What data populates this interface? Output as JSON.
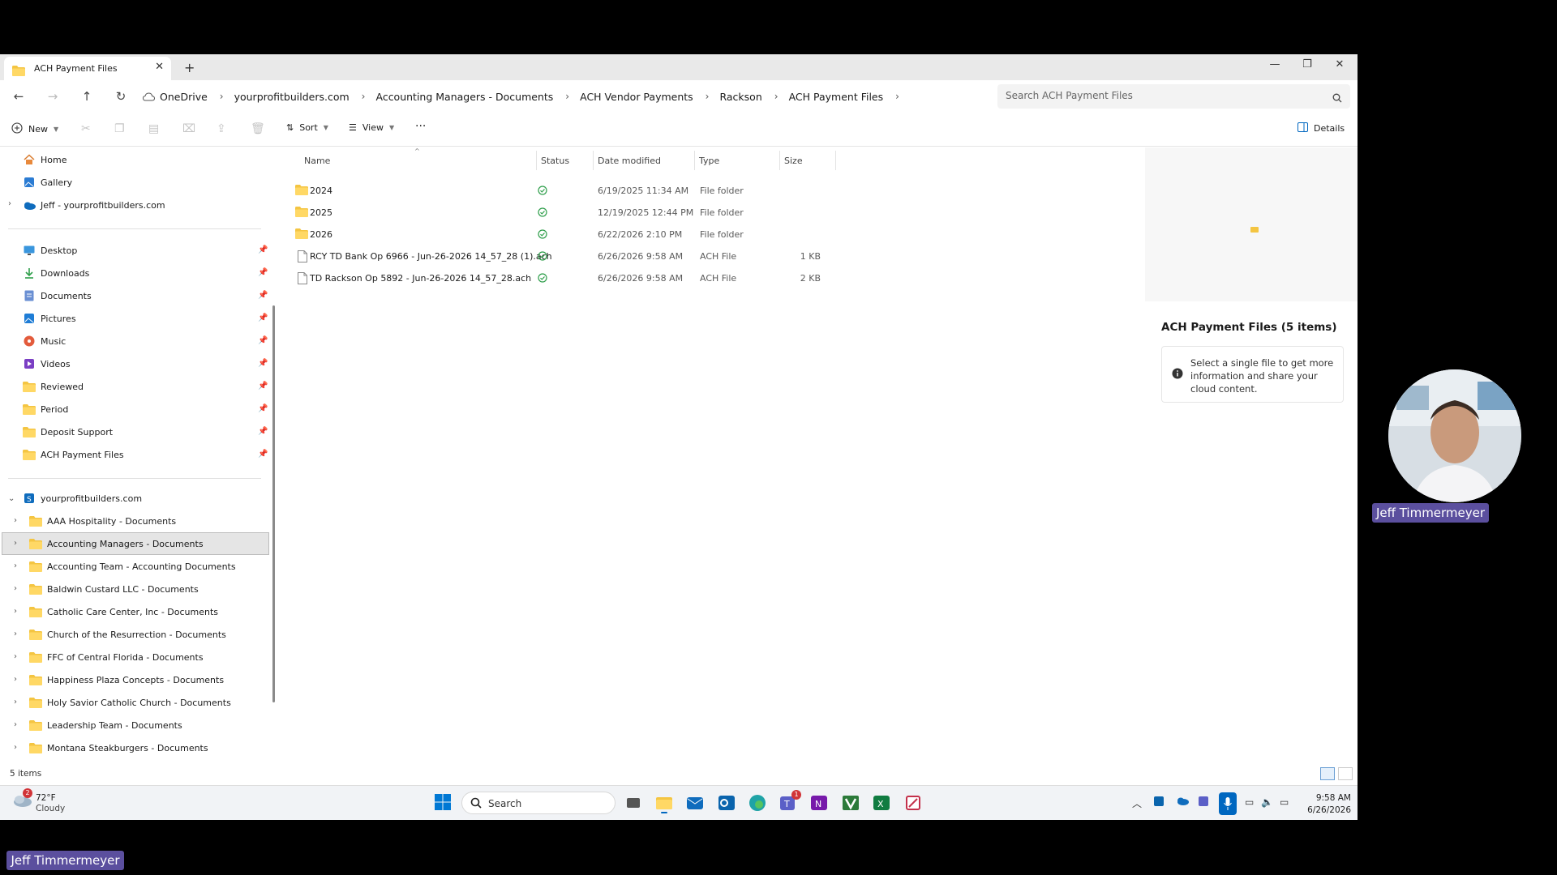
{
  "window": {
    "tab_title": "ACH Payment Files",
    "tab_close": "✕",
    "new_tab": "+",
    "controls": {
      "minimize": "—",
      "restore": "❐",
      "close": "✕"
    }
  },
  "address": {
    "breadcrumbs": [
      "OneDrive",
      "yourprofitbuilders.com",
      "Accounting Managers - Documents",
      "ACH Vendor Payments",
      "Rackson",
      "ACH Payment Files"
    ],
    "separator": "›",
    "search_placeholder": "Search ACH Payment Files"
  },
  "toolbar": {
    "new_label": "New",
    "sort_label": "Sort",
    "view_label": "View",
    "more_label": "···",
    "details_label": "Details"
  },
  "nav": {
    "top_items": [
      {
        "label": "Home",
        "icon": "home-icon"
      },
      {
        "label": "Gallery",
        "icon": "gallery-icon"
      },
      {
        "label": "Jeff - yourprofitbuilders.com",
        "icon": "onedrive-icon"
      }
    ],
    "pinned": [
      {
        "label": "Desktop",
        "icon": "desktop-icon"
      },
      {
        "label": "Downloads",
        "icon": "downloads-icon"
      },
      {
        "label": "Documents",
        "icon": "documents-icon"
      },
      {
        "label": "Pictures",
        "icon": "pictures-icon"
      },
      {
        "label": "Music",
        "icon": "music-icon"
      },
      {
        "label": "Videos",
        "icon": "videos-icon"
      },
      {
        "label": "Reviewed",
        "icon": "folder-icon"
      },
      {
        "label": "Period",
        "icon": "folder-icon"
      },
      {
        "label": "Deposit Support",
        "icon": "folder-icon"
      },
      {
        "label": "ACH Payment Files",
        "icon": "folder-icon"
      }
    ],
    "org_label": "yourprofitbuilders.com",
    "libraries": [
      "AAA Hospitality - Documents",
      "Accounting Managers - Documents",
      "Accounting Team - Accounting Documents",
      "Baldwin Custard LLC - Documents",
      "Catholic Care Center, Inc - Documents",
      "Church of the Resurrection - Documents",
      "FFC of Central Florida - Documents",
      "Happiness Plaza Concepts - Documents",
      "Holy Savior Catholic Church - Documents",
      "Leadership Team - Documents",
      "Montana Steakburgers - Documents"
    ],
    "selected_library": "Accounting Managers - Documents"
  },
  "files": {
    "columns": {
      "name": "Name",
      "status": "Status",
      "date": "Date modified",
      "type": "Type",
      "size": "Size"
    },
    "rows": [
      {
        "name": "2024",
        "date": "6/19/2025 11:34 AM",
        "type": "File folder",
        "size": "",
        "kind": "folder"
      },
      {
        "name": "2025",
        "date": "12/19/2025 12:44 PM",
        "type": "File folder",
        "size": "",
        "kind": "folder"
      },
      {
        "name": "2026",
        "date": "6/22/2026 2:10 PM",
        "type": "File folder",
        "size": "",
        "kind": "folder"
      },
      {
        "name": "RCY TD Bank Op 6966 - Jun-26-2026 14_57_28 (1).ach",
        "date": "6/26/2026 9:58 AM",
        "type": "ACH File",
        "size": "1 KB",
        "kind": "file"
      },
      {
        "name": "TD Rackson Op 5892 - Jun-26-2026 14_57_28.ach",
        "date": "6/26/2026 9:58 AM",
        "type": "ACH File",
        "size": "2 KB",
        "kind": "file"
      }
    ],
    "status_icon": "synced-check-icon"
  },
  "details_pane": {
    "title": "ACH Payment Files (5 items)",
    "message": "Select a single file to get more information and share your cloud content."
  },
  "statusbar": {
    "item_count": "5 items"
  },
  "taskbar": {
    "weather_temp": "72°F",
    "weather_cond": "Cloudy",
    "weather_badge": "2",
    "search_label": "Search",
    "teams_badge": "1",
    "time": "9:58 AM",
    "date": "6/26/2026"
  },
  "participant": {
    "name": "Jeff Timmermeyer"
  },
  "colors": {
    "accent": "#0067c0",
    "folder": "#f4c542",
    "synced": "#2e9e4a",
    "badge": "#5b4f9e"
  }
}
